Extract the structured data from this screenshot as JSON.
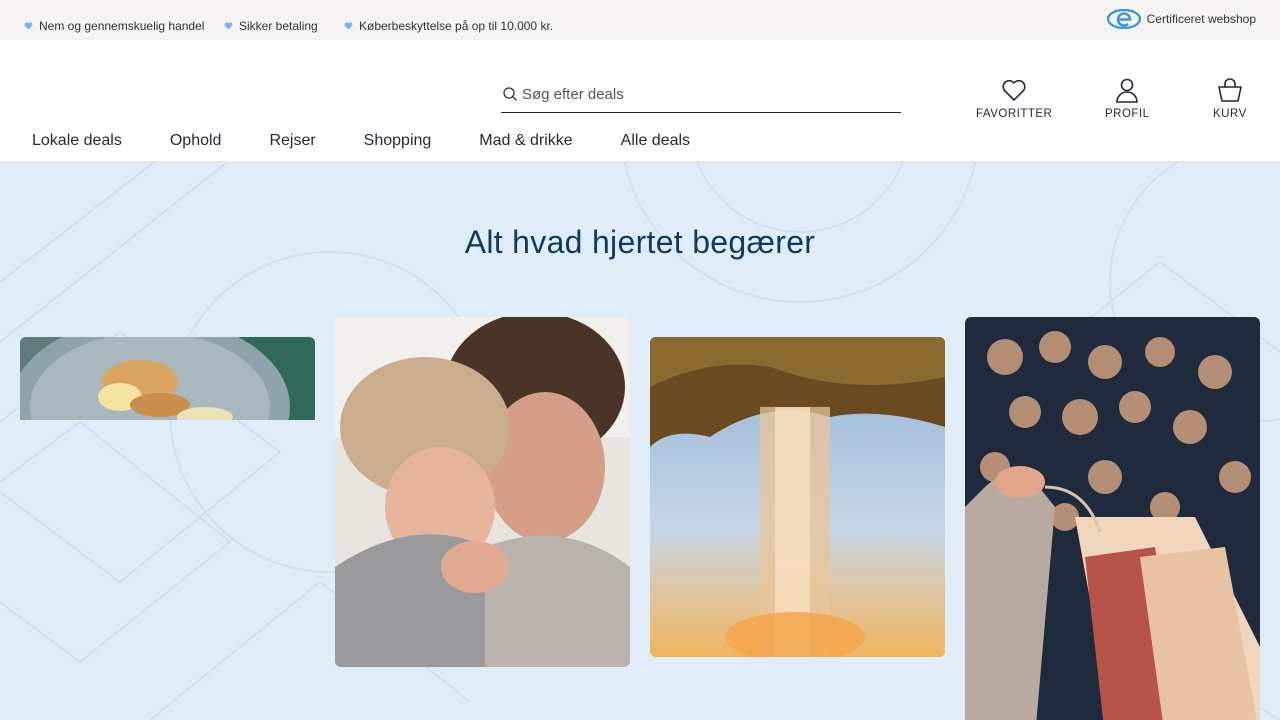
{
  "topbar": {
    "usps": [
      "Nem og gennemskuelig handel",
      "Sikker betaling",
      "Køberbeskyttelse på op til 10.000 kr."
    ],
    "certificate": "Certificeret webshop"
  },
  "search": {
    "placeholder": "Søg efter deals"
  },
  "actions": {
    "favorites": "FAVORITTER",
    "profile": "PROFIL",
    "cart": "KURV"
  },
  "nav": [
    "Lokale deals",
    "Ophold",
    "Rejser",
    "Shopping",
    "Mad & drikke",
    "Alle deals"
  ],
  "hero": {
    "title": "Alt hvad hjertet begærer"
  },
  "colors": {
    "hero_bg": "#e0ecf7",
    "title": "#123a5e",
    "heart": "#7fb3e6"
  },
  "icons": [
    "heart-icon",
    "certificate-icon",
    "search-icon",
    "profile-icon",
    "cart-icon"
  ]
}
